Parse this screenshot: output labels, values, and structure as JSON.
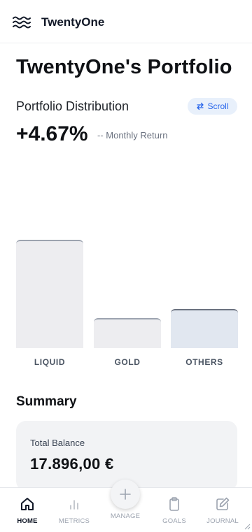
{
  "app": {
    "brand": "TwentyOne"
  },
  "page": {
    "title": "TwentyOne's Portfolio"
  },
  "distribution": {
    "title": "Portfolio Distribution",
    "scroll_label": "Scroll",
    "return_value": "+4.67%",
    "return_label": "-- Monthly Return"
  },
  "chart_data": {
    "type": "bar",
    "categories": [
      "LIQUID",
      "GOLD",
      "OTHERS"
    ],
    "values": [
      100,
      28,
      36
    ],
    "ylim": [
      0,
      100
    ],
    "grid": false,
    "colors": [
      "#ededf0",
      "#ededf0",
      "#e1e7f0"
    ],
    "top_border_colors": [
      "#9ca3af",
      "#9ca3af",
      "#6b7280"
    ]
  },
  "summary": {
    "title": "Summary",
    "balance_label": "Total Balance",
    "balance_value": "17.896,00 €"
  },
  "nav": {
    "home": "HOME",
    "metrics": "METRICS",
    "manage": "MANAGE",
    "goals": "GOALS",
    "journal": "JOURNAL",
    "active": "home"
  },
  "icons": {
    "logo": "waves-icon",
    "scroll": "swap-arrows-icon",
    "home": "home-icon",
    "metrics": "bar-chart-icon",
    "manage": "plus-icon",
    "goals": "clipboard-icon",
    "journal": "edit-icon"
  }
}
